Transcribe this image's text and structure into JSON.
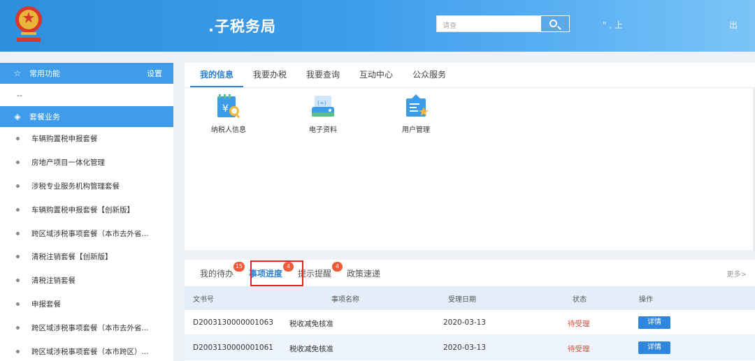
{
  "header": {
    "title": ".子税务局",
    "search_placeholder": "请查",
    "user_info": "\" , 上",
    "logout": "出"
  },
  "sidebar": {
    "favorites_label": "常用功能",
    "settings_label": "设置",
    "favorites_empty": "--",
    "package_label": "套餐业务",
    "items": [
      {
        "label": "车辆购置税申报套餐"
      },
      {
        "label": "房地产项目一体化管理"
      },
      {
        "label": "涉税专业服务机构管理套餐"
      },
      {
        "label": "车辆购置税申报套餐【创新版】"
      },
      {
        "label": "跨区域涉税事项套餐（本市去外省..."
      },
      {
        "label": "清税注销套餐【创新版】"
      },
      {
        "label": "清税注销套餐"
      },
      {
        "label": "申报套餐"
      },
      {
        "label": "跨区域涉税事项套餐（本市去外省..."
      },
      {
        "label": "跨区域涉税事项套餐（本市跨区）..."
      }
    ]
  },
  "main_tabs": [
    "我的信息",
    "我要办税",
    "我要查询",
    "互动中心",
    "公众服务"
  ],
  "apps": [
    {
      "label": "纳税人信息",
      "icon": "taxpayer-info-icon"
    },
    {
      "label": "电子资料",
      "icon": "electronic-data-icon"
    },
    {
      "label": "用户管理",
      "icon": "user-management-icon"
    }
  ],
  "bottom_tabs": [
    {
      "label": "我的待办",
      "badge": "15"
    },
    {
      "label": "事项进度",
      "badge": "4"
    },
    {
      "label": "提示提醒",
      "badge": "4"
    },
    {
      "label": "政策速递",
      "badge": ""
    }
  ],
  "more_label": "更多>",
  "table": {
    "headers": [
      "文书号",
      "事项名称",
      "受理日期",
      "状态",
      "操作"
    ],
    "rows": [
      {
        "doc_no": "D2003130000001063",
        "item": "税收减免核准",
        "date": "2020-03-13",
        "status": "待受理",
        "action": "详情"
      },
      {
        "doc_no": "D2003130000001061",
        "item": "税收减免核准",
        "date": "2020-03-13",
        "status": "待受理",
        "action": "详情"
      }
    ]
  },
  "colors": {
    "header_blue": "#3b9cea",
    "accent": "#2b7fd5",
    "badge_red": "#f05a3c",
    "status_red": "#e2463b"
  }
}
